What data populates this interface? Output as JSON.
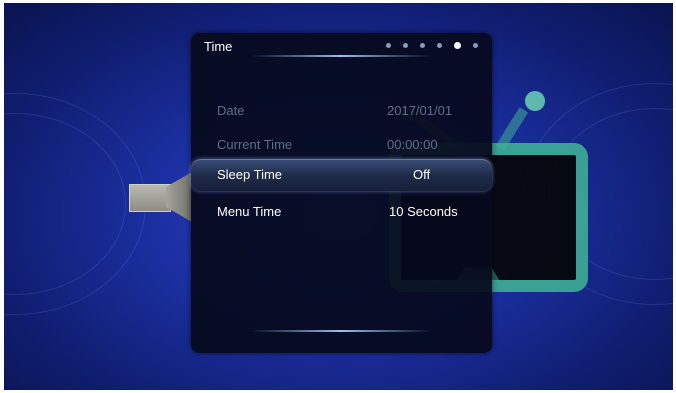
{
  "panel": {
    "title": "Time",
    "page_indicator": {
      "total": 6,
      "active": 5
    }
  },
  "rows": [
    {
      "label": "Date",
      "value": "2017/01/01",
      "state": "disabled"
    },
    {
      "label": "Current Time",
      "value": "00:00:00",
      "state": "disabled"
    },
    {
      "label": "Sleep Time",
      "value": "Off",
      "state": "selected"
    },
    {
      "label": "Menu Time",
      "value": "10 Seconds",
      "state": "normal"
    }
  ],
  "colors": {
    "background": "#1a2fa0",
    "panel": "#060a1c",
    "accent": "#3fae95",
    "disabled_text": "#5e6e8a"
  }
}
